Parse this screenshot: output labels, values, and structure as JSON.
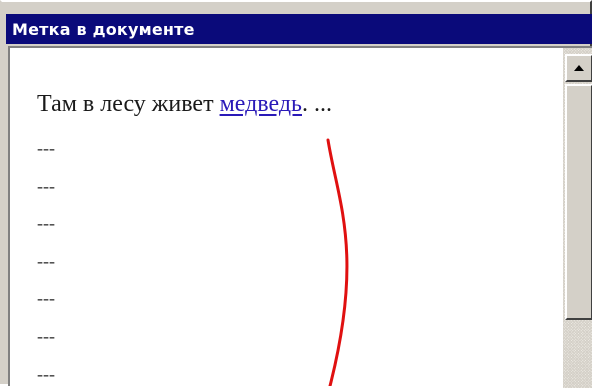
{
  "window": {
    "title": "Метка в документе"
  },
  "document": {
    "first_line": {
      "before": "Там в лесу живет ",
      "link": "медведь",
      "after": ". ..."
    },
    "placeholder_lines": [
      "---",
      "---",
      "---",
      "---",
      "---",
      "---",
      "---"
    ]
  },
  "scrollbar": {
    "up_icon": "triangle-up-icon"
  },
  "colors": {
    "titlebar": "#0a0a7a",
    "link": "#2a1ab8",
    "annotation": "#e01010"
  }
}
